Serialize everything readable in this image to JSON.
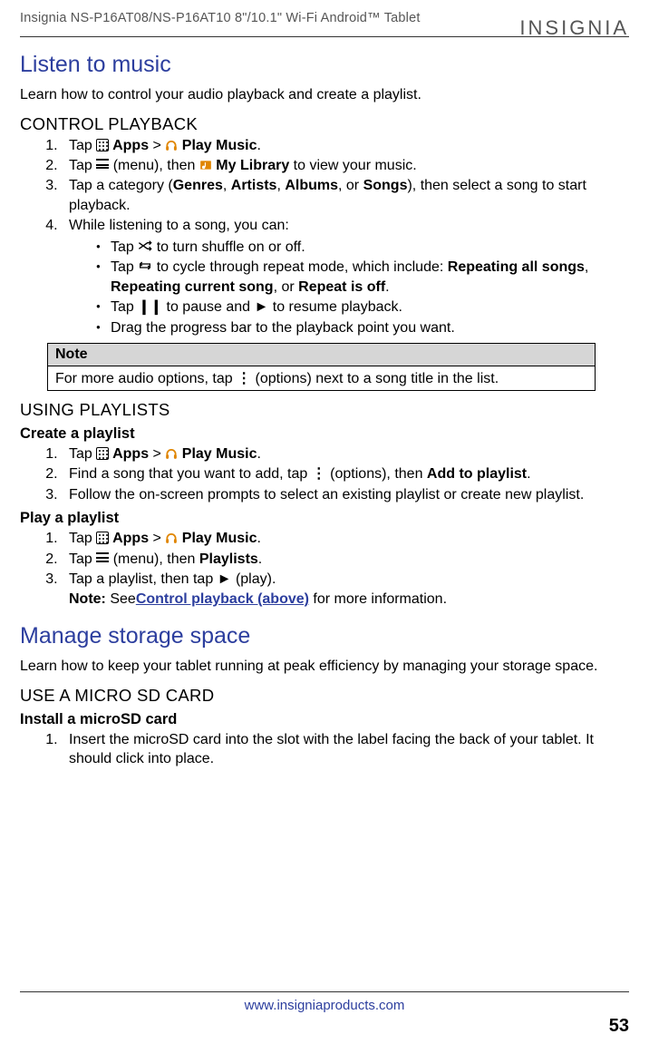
{
  "header": {
    "product_line": "Insignia  NS-P16AT08/NS-P16AT10  8\"/10.1\" Wi-Fi Android™ Tablet",
    "brand": "INSIGNIA"
  },
  "music": {
    "title": "Listen to music",
    "intro": "Learn how to control your audio playback and create a playlist.",
    "control": {
      "heading": "CONTROL PLAYBACK",
      "step1_a": "Tap ",
      "step1_b": " Apps",
      "step1_c": " > ",
      "step1_d": " Play Music",
      "step1_e": ".",
      "step2_a": "Tap ",
      "step2_b": " (menu), then ",
      "step2_c": " My Library",
      "step2_d": " to view your music.",
      "step3_a": "Tap a category (",
      "step3_b": "Genres",
      "step3_c": ", ",
      "step3_d": "Artists",
      "step3_e": ", ",
      "step3_f": "Albums",
      "step3_g": ", or ",
      "step3_h": "Songs",
      "step3_i": "), then select a song to start playback.",
      "step4": "While listening to a song, you can:",
      "b1_a": "Tap ",
      "b1_b": " to turn shuffle on or off.",
      "b2_a": "Tap ",
      "b2_b": " to cycle through repeat mode, which include: ",
      "b2_c": "Repeating all songs",
      "b2_d": ", ",
      "b2_e": "Repeating current song",
      "b2_f": ", or ",
      "b2_g": "Repeat is off",
      "b2_h": ".",
      "b3_a": "Tap ",
      "b3_b": " to pause and ► to resume playback.",
      "b4": "Drag the progress bar to the playback point you want."
    },
    "note": {
      "label": "Note",
      "body_a": "For more audio options, tap ",
      "body_b": " (options) next to a song title in the list."
    },
    "playlists": {
      "heading": "USING PLAYLISTS",
      "create": {
        "title": "Create a playlist",
        "s1_a": "Tap ",
        "s1_b": " Apps",
        "s1_c": " > ",
        "s1_d": " Play Music",
        "s1_e": ".",
        "s2_a": "Find a song that you want to add, tap ",
        "s2_b": " (options), then ",
        "s2_c": "Add to playlist",
        "s2_d": ".",
        "s3": "Follow the on-screen prompts to select an existing playlist or create new playlist."
      },
      "play": {
        "title": "Play a playlist",
        "s1_a": "Tap ",
        "s1_b": " Apps",
        "s1_c": " > ",
        "s1_d": " Play Music",
        "s1_e": ".",
        "s2_a": "Tap ",
        "s2_b": " (menu), then ",
        "s2_c": "Playlists",
        "s2_d": ".",
        "s3_a": "Tap a playlist, then tap ► (play).",
        "s3_b": "Note:",
        "s3_c": " See",
        "s3_link": "Control playback (above)",
        "s3_d": " for more information."
      }
    }
  },
  "storage": {
    "title": "Manage storage space",
    "intro": "Learn how to keep your tablet running at peak efficiency by managing your storage space.",
    "sd": {
      "heading": "USE A MICRO SD CARD",
      "install_title": "Install a microSD card",
      "s1": "Insert the microSD card into the slot with the label facing the back of your tablet. It should click into place."
    }
  },
  "footer": {
    "url": "www.insigniaproducts.com",
    "page": "53"
  },
  "icons": {
    "shuffle": "✕",
    "repeat": "⟲",
    "pause": "❙❙",
    "dots": "⋮"
  }
}
